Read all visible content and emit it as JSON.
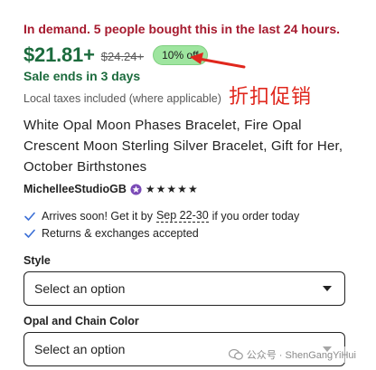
{
  "listing": {
    "demand_text": "In demand. 5 people bought this in the last 24 hours.",
    "price": "$21.81+",
    "original_price": "$24.24+",
    "discount_badge": "10% off",
    "sale_ends": "Sale ends in 3 days",
    "taxes_note": "Local taxes included (where applicable)",
    "title": "White Opal Moon Phases Bracelet, Fire Opal Crescent Moon Sterling Silver Bracelet, Gift for Her, October Birthstones",
    "shop_name": "MichelleeStudioGB",
    "rating_stars": "★★★★★"
  },
  "annotation": {
    "text": "折扣促销",
    "color": "#e0271d"
  },
  "delivery": {
    "arrives_prefix": "Arrives soon! Get it by",
    "arrives_date": "Sep 22-30",
    "arrives_suffix": "if you order today",
    "returns": "Returns & exchanges accepted"
  },
  "options": {
    "style_label": "Style",
    "style_value": "Select an option",
    "color_label": "Opal and Chain Color",
    "color_value": "Select an option"
  },
  "watermark": {
    "text": "公众号 · ShenGangYiHui"
  },
  "colors": {
    "demand_red": "#a61a2e",
    "price_green": "#1c6b3d",
    "badge_green": "#9ee59f"
  }
}
